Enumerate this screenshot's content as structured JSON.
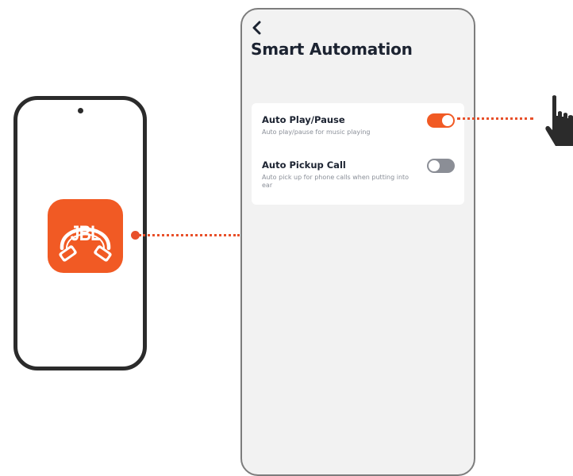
{
  "screen": {
    "back_icon": "chevron-left-icon",
    "title": "Smart Automation"
  },
  "settings": [
    {
      "title": "Auto Play/Pause",
      "description": "Auto play/pause for music playing",
      "enabled": true
    },
    {
      "title": "Auto Pickup Call",
      "description": "Auto pick up for phone calls when putting into ear",
      "enabled": false
    }
  ],
  "app": {
    "name": "JBL Headphones",
    "logo_text": "JBL",
    "icon": "headphones-icon"
  },
  "colors": {
    "accent": "#f15a24",
    "connector": "#e8502a",
    "toggle_off": "#8b8e96",
    "screen_bg": "#f2f2f2",
    "title_text": "#1c2331"
  },
  "pointer": {
    "icon": "hand-pointer-icon"
  }
}
